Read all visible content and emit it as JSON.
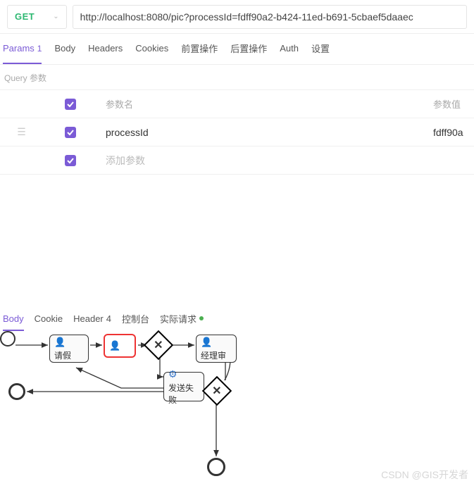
{
  "request": {
    "method": "GET",
    "url": "http://localhost:8080/pic?processId=fdff90a2-b424-11ed-b691-5cbaef5daaec"
  },
  "tabs": {
    "params": "Params",
    "params_count": "1",
    "body": "Body",
    "headers": "Headers",
    "cookies": "Cookies",
    "pre": "前置操作",
    "post": "后置操作",
    "auth": "Auth",
    "settings": "设置"
  },
  "params_section": {
    "label": "Query 参数",
    "columns": {
      "name": "参数名",
      "value": "参数值"
    },
    "rows": [
      {
        "name": "processId",
        "value": "fdff90a"
      }
    ],
    "add_placeholder": "添加参数"
  },
  "response_tabs": {
    "body": "Body",
    "cookie": "Cookie",
    "header": "Header",
    "header_count": "4",
    "console": "控制台",
    "actual": "实际请求"
  },
  "diagram": {
    "task1": "请假",
    "task2_label": "",
    "task3": "经理审",
    "task4": "发送失败"
  },
  "watermark": "CSDN @GIS开发者"
}
